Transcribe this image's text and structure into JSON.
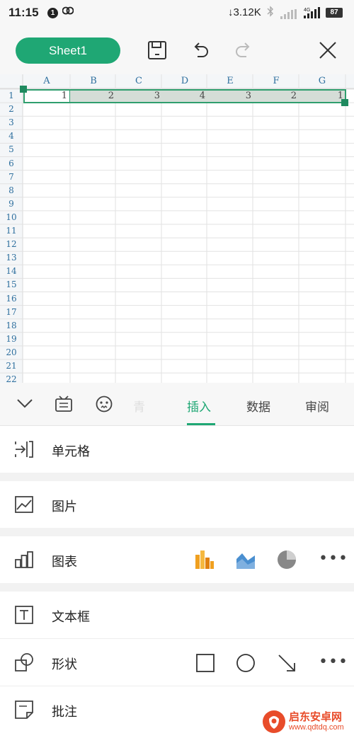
{
  "status_bar": {
    "time": "11:15",
    "notification_count": "1",
    "network_speed": "↓3.12K",
    "network_type": "4G",
    "battery": "87"
  },
  "toolbar": {
    "sheet_label": "Sheet1"
  },
  "spreadsheet": {
    "columns": [
      "A",
      "B",
      "C",
      "D",
      "E",
      "F",
      "G"
    ],
    "rows": [
      "1",
      "2",
      "3",
      "4",
      "5",
      "6",
      "7",
      "8",
      "9",
      "10",
      "11",
      "12",
      "13",
      "14",
      "15",
      "16",
      "17",
      "18",
      "19",
      "20",
      "21",
      "22"
    ],
    "row1_values": [
      "1",
      "2",
      "3",
      "4",
      "3",
      "2",
      "1"
    ]
  },
  "tabs": {
    "items": [
      "插入",
      "数据",
      "审阅"
    ],
    "faded_item": "青",
    "active": "插入"
  },
  "insert_menu": {
    "cell": "单元格",
    "picture": "图片",
    "chart": "图表",
    "textbox": "文本框",
    "shape": "形状",
    "comment": "批注"
  },
  "watermark": {
    "title": "启东安卓网",
    "url": "www.qdtdq.com"
  },
  "colors": {
    "accent": "#1fa774",
    "selection_border": "#2f9e6e",
    "selection_fill": "#d5ddd7",
    "header_text": "#2e6f9e",
    "chart_orange": "#f0a020",
    "chart_blue": "#4a8fd0",
    "pie_gray": "#888888"
  }
}
